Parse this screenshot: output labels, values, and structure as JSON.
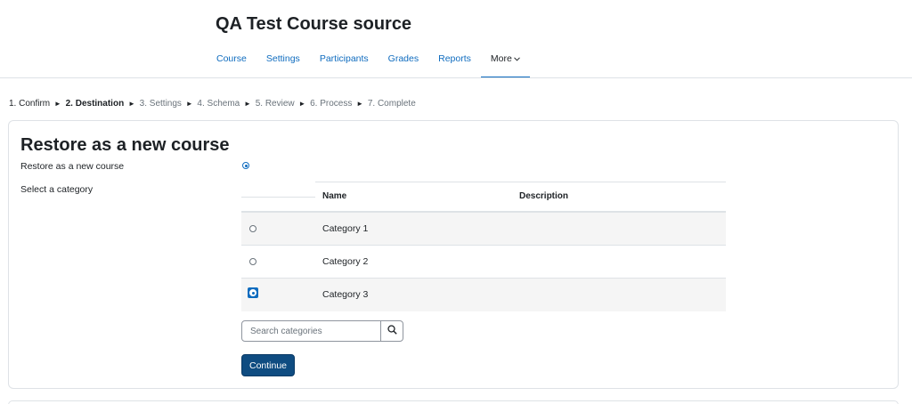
{
  "header": {
    "course_title": "QA Test Course source"
  },
  "secondary_nav": {
    "tabs": [
      {
        "label": "Course"
      },
      {
        "label": "Settings"
      },
      {
        "label": "Participants"
      },
      {
        "label": "Grades"
      },
      {
        "label": "Reports"
      },
      {
        "label": "More"
      }
    ],
    "active": "More"
  },
  "steps": {
    "s1": "1. Confirm",
    "s2": "2. Destination",
    "s3": "3. Settings",
    "s4": "4. Schema",
    "s5": "5. Review",
    "s6": "6. Process",
    "s7": "7. Complete",
    "separator": "►",
    "current": "2. Destination"
  },
  "form": {
    "heading": "Restore as a new course",
    "restore_label": "Restore as a new course",
    "restore_selected": true,
    "category_label": "Select a category",
    "table": {
      "columns": [
        "Name",
        "Description"
      ],
      "rows": [
        {
          "name": "Category 1",
          "description": "",
          "selected": false
        },
        {
          "name": "Category 2",
          "description": "",
          "selected": false
        },
        {
          "name": "Category 3",
          "description": "",
          "selected": true
        }
      ]
    },
    "search": {
      "placeholder": "Search categories",
      "value": ""
    },
    "continue_label": "Continue"
  },
  "colors": {
    "link": "#0f6cbf",
    "primary_button": "#0f4c81",
    "border": "#dee2e6"
  }
}
